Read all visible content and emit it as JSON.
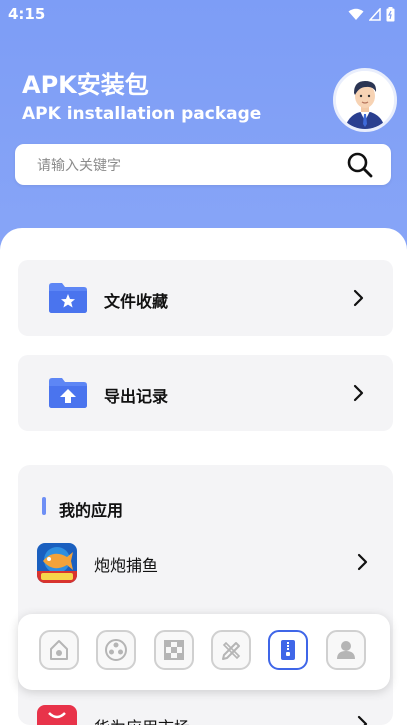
{
  "status": {
    "time": "4:15"
  },
  "header": {
    "title": "APK安装包",
    "subtitle": "APK installation package"
  },
  "search": {
    "placeholder": "请输入关键字"
  },
  "menu": [
    {
      "label": "文件收藏",
      "icon": "folder-star-icon"
    },
    {
      "label": "导出记录",
      "icon": "folder-upload-icon"
    }
  ],
  "apps_section": {
    "title": "我的应用",
    "items": [
      {
        "label": "炮炮捕鱼",
        "icon": "fishing-game-icon"
      },
      {
        "label": "华为应用市场",
        "icon": "huawei-appgallery-icon"
      }
    ]
  },
  "toolbar": {
    "items": [
      "home-icon",
      "film-reel-icon",
      "checkerboard-icon",
      "pencil-ruler-icon",
      "zip-file-icon",
      "person-icon"
    ],
    "active": "zip-file-icon"
  },
  "colors": {
    "accent": "#6e8ff5",
    "active_tool": "#3f66e8"
  }
}
